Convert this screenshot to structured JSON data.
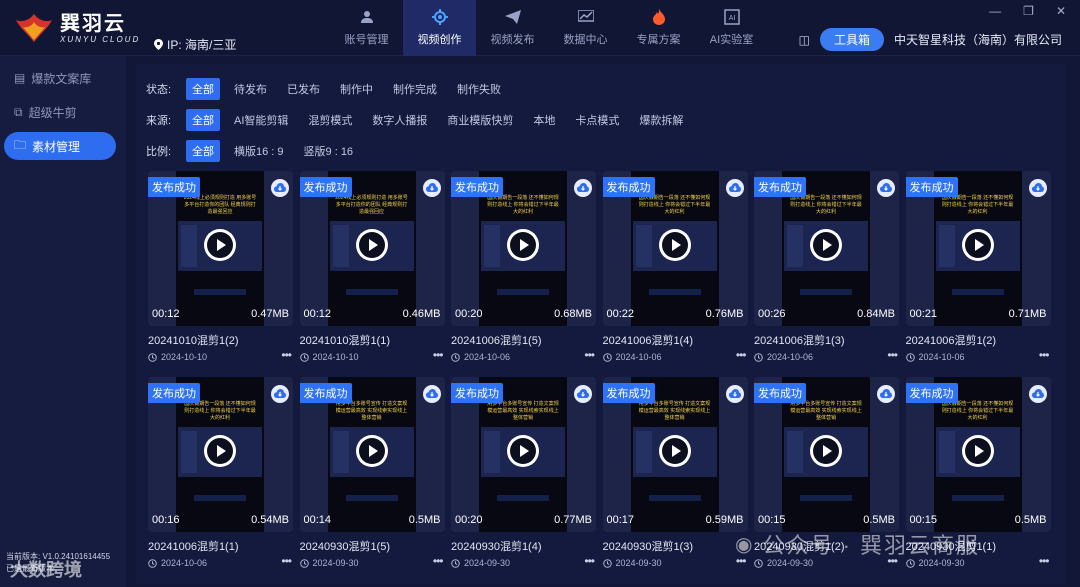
{
  "app": {
    "brand_cn": "巽羽云",
    "brand_en": "XUNYU CLOUD",
    "ip_label": "IP: 海南/三亚"
  },
  "nav": [
    {
      "label": "账号管理",
      "icon": "user-icon",
      "active": false
    },
    {
      "label": "视频创作",
      "icon": "gear-robot-icon",
      "active": true
    },
    {
      "label": "视频发布",
      "icon": "send-icon",
      "active": false
    },
    {
      "label": "数据中心",
      "icon": "chart-icon",
      "active": false
    },
    {
      "label": "专属方案",
      "icon": "fire-icon",
      "active": false
    },
    {
      "label": "AI实验室",
      "icon": "ai-icon",
      "active": false
    }
  ],
  "header": {
    "toolbox": "工具箱",
    "company": "中天智星科技（海南）有限公司"
  },
  "sidebar": {
    "items": [
      {
        "label": "爆款文案库",
        "active": false
      },
      {
        "label": "超级牛剪",
        "active": false
      },
      {
        "label": "素材管理",
        "active": true
      }
    ],
    "version": "当前版本: V1.0.24101614455",
    "update": "已是最新版本"
  },
  "filters": {
    "status_label": "状态:",
    "status": [
      "全部",
      "待发布",
      "已发布",
      "制作中",
      "制作完成",
      "制作失败"
    ],
    "source_label": "来源:",
    "source": [
      "全部",
      "AI智能剪辑",
      "混剪模式",
      "数字人播报",
      "商业模版快剪",
      "本地",
      "卡点模式",
      "爆款拆解"
    ],
    "ratio_label": "比例:",
    "ratio": [
      "全部",
      "横版16 : 9",
      "竖版9 : 16"
    ]
  },
  "cards": [
    {
      "title": "20241010混剪1(2)",
      "date": "2024-10-10",
      "duration": "00:12",
      "size": "0.47MB",
      "badge": "发布成功",
      "caption": "2024线上必须规则打造 用多账号多平台打造你的团队 经典规则打造最强回应"
    },
    {
      "title": "20241010混剪1(1)",
      "date": "2024-10-10",
      "duration": "00:12",
      "size": "0.46MB",
      "badge": "发布成功",
      "caption": "2024线上必须规则打造 用多账号多平台打造你的团队 经典规则打造最强回应"
    },
    {
      "title": "20241006混剪1(5)",
      "date": "2024-10-06",
      "duration": "00:20",
      "size": "0.68MB",
      "badge": "发布成功",
      "caption": "国庆假期告一段落 还不懂如何规则打造线上 你将会错过下半年最大的红利"
    },
    {
      "title": "20241006混剪1(4)",
      "date": "2024-10-06",
      "duration": "00:22",
      "size": "0.76MB",
      "badge": "发布成功",
      "caption": "国庆假期告一段落 还不懂如何规则打造线上 你将会错过下半年最大的红利"
    },
    {
      "title": "20241006混剪1(3)",
      "date": "2024-10-06",
      "duration": "00:26",
      "size": "0.84MB",
      "badge": "发布成功",
      "caption": "国庆假期告一段落 还不懂如何规则打造线上 你将会错过下半年最大的红利"
    },
    {
      "title": "20241006混剪1(2)",
      "date": "2024-10-06",
      "duration": "00:21",
      "size": "0.71MB",
      "badge": "发布成功",
      "caption": "国庆假期告一段落 还不懂如何规则打造线上 你将会错过下半年最大的红利"
    },
    {
      "title": "20241006混剪1(1)",
      "date": "2024-10-06",
      "duration": "00:16",
      "size": "0.54MB",
      "badge": "发布成功",
      "caption": "国庆假期告一段落 还不懂如何规则打造线上 你将会错过下半年最大的红利"
    },
    {
      "title": "20240930混剪1(5)",
      "date": "2024-09-30",
      "duration": "00:14",
      "size": "0.5MB",
      "badge": "发布成功",
      "caption": "用多平台多账号宣传 打造文案规模运营最高效 实现线索实现线上整体营销"
    },
    {
      "title": "20240930混剪1(4)",
      "date": "2024-09-30",
      "duration": "00:20",
      "size": "0.77MB",
      "badge": "发布成功",
      "caption": "用多平台多账号宣传 打造文案规模运营最高效 实现线索实现线上整体营销"
    },
    {
      "title": "20240930混剪1(3)",
      "date": "2024-09-30",
      "duration": "00:17",
      "size": "0.59MB",
      "badge": "发布成功",
      "caption": "用多平台多账号宣传 打造文案规模运营最高效 实现线索实现线上整体营销"
    },
    {
      "title": "20240930混剪1(2)",
      "date": "2024-09-30",
      "duration": "00:15",
      "size": "0.5MB",
      "badge": "发布成功",
      "caption": "用多平台多账号宣传 打造文案规模运营最高效 实现线索实现线上整体营销"
    },
    {
      "title": "20240930混剪1(1)",
      "date": "2024-09-30",
      "duration": "00:15",
      "size": "0.5MB",
      "badge": "发布成功",
      "caption": "国庆假期告一段落 还不懂如何规则打造线上 你将会错过下半年最大的红利"
    }
  ],
  "watermark": {
    "right": "公众号 · 巽羽云商服",
    "left": "大数跨境"
  },
  "colors": {
    "accent": "#2e6cf0",
    "badge": "#2e73f5",
    "bg": "#121738"
  }
}
